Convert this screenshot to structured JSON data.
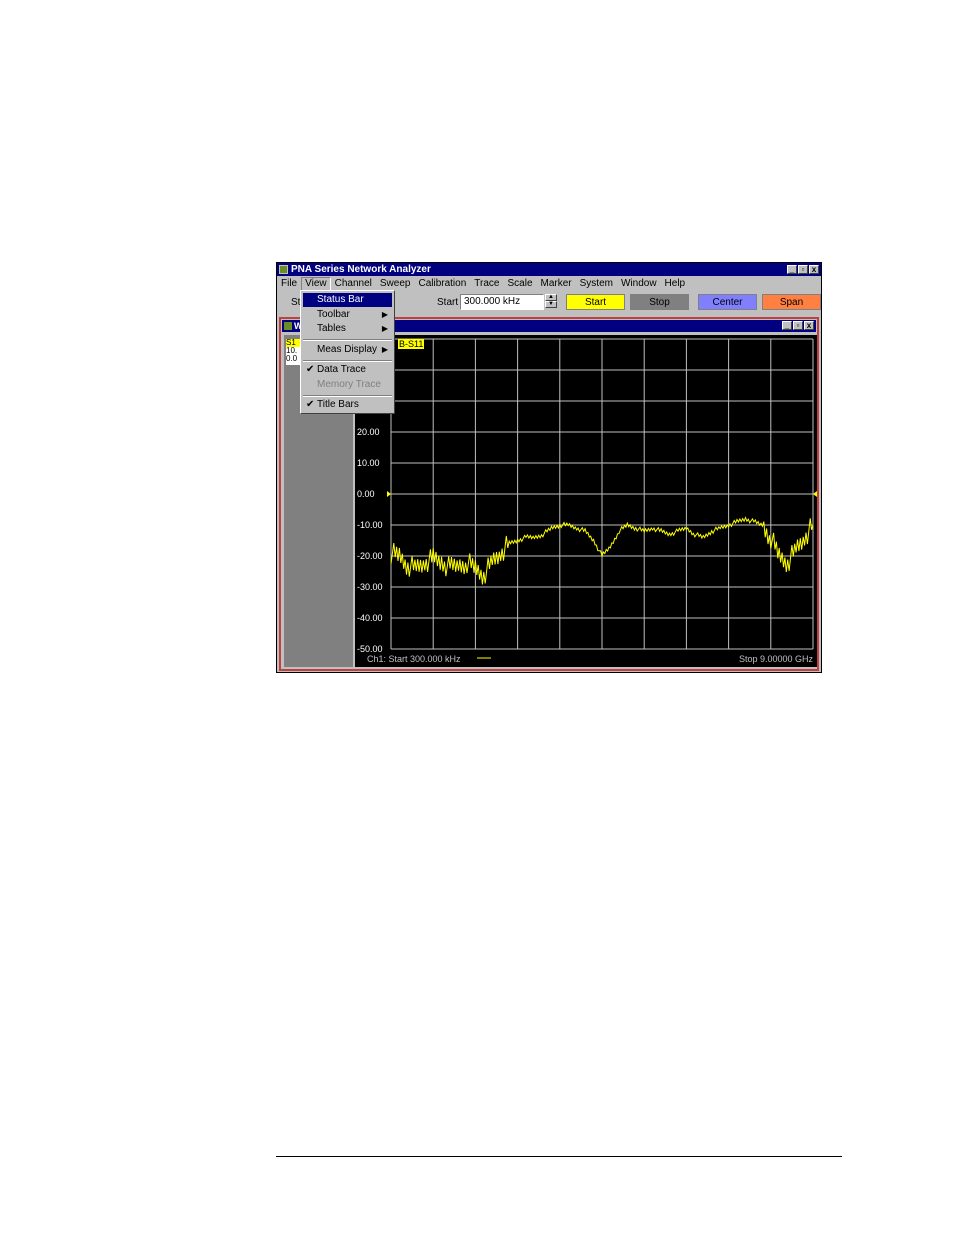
{
  "app": {
    "title": "PNA Series Network Analyzer",
    "window_buttons": [
      "_",
      "▫",
      "x"
    ]
  },
  "menubar": [
    "File",
    "View",
    "Channel",
    "Sweep",
    "Calibration",
    "Trace",
    "Scale",
    "Marker",
    "System",
    "Window",
    "Help"
  ],
  "toolbar": {
    "left_label": "St",
    "start_label": "Start",
    "start_value": "300.000 kHz",
    "buttons": [
      {
        "label": "Start",
        "color": "#ffff00"
      },
      {
        "label": "Stop",
        "color": "#808080"
      },
      {
        "label": "Center",
        "color": "#8080ff"
      },
      {
        "label": "Span",
        "color": "#ff8040"
      }
    ]
  },
  "view_menu": {
    "items": [
      {
        "label": "Status Bar",
        "selected": true
      },
      {
        "label": "Toolbar",
        "submenu": true
      },
      {
        "label": "Tables",
        "submenu": true
      },
      {
        "label": "Meas Display",
        "submenu": true
      },
      {
        "label": "Data Trace",
        "checked": true
      },
      {
        "label": "Memory Trace",
        "disabled": true
      },
      {
        "label": "Title Bars",
        "checked": true
      }
    ]
  },
  "child_window": {
    "title": "W",
    "left_panel_lines": [
      "S1",
      "10.",
      "0.0"
    ],
    "trace_label": "B-S11"
  },
  "chart_data": {
    "type": "line",
    "ylabel_ticks": [
      "20.00",
      "10.00",
      "0.00",
      "-10.00",
      "-20.00",
      "-30.00",
      "-40.00",
      "-50.00"
    ],
    "ylim": [
      -50,
      50
    ],
    "reference_level": 0,
    "footer_left": "Ch1: Start 300.000 kHz",
    "footer_right": "Stop 9.00000 GHz",
    "grid": true,
    "trace_color": "#ffff00",
    "x_fraction": [
      0.0,
      0.02,
      0.04,
      0.06,
      0.08,
      0.1,
      0.12,
      0.14,
      0.16,
      0.18,
      0.2,
      0.22,
      0.24,
      0.26,
      0.28,
      0.3,
      0.32,
      0.34,
      0.36,
      0.38,
      0.4,
      0.42,
      0.44,
      0.46,
      0.48,
      0.5,
      0.52,
      0.54,
      0.56,
      0.58,
      0.6,
      0.62,
      0.64,
      0.66,
      0.68,
      0.7,
      0.72,
      0.74,
      0.76,
      0.78,
      0.8,
      0.82,
      0.84,
      0.86,
      0.88,
      0.9,
      0.92,
      0.94,
      0.96,
      0.98,
      1.0
    ],
    "values": [
      -19,
      -20,
      -23,
      -24,
      -22,
      -21,
      -22,
      -24,
      -23,
      -22,
      -24,
      -26,
      -22,
      -19,
      -16,
      -15,
      -14,
      -14,
      -13,
      -11,
      -10,
      -10,
      -11,
      -12,
      -15,
      -20,
      -17,
      -12,
      -10,
      -11,
      -12,
      -11,
      -12,
      -13,
      -12,
      -11,
      -13,
      -14,
      -12,
      -11,
      -10,
      -9,
      -8,
      -9,
      -10,
      -14,
      -20,
      -22,
      -18,
      -14,
      -10
    ]
  }
}
